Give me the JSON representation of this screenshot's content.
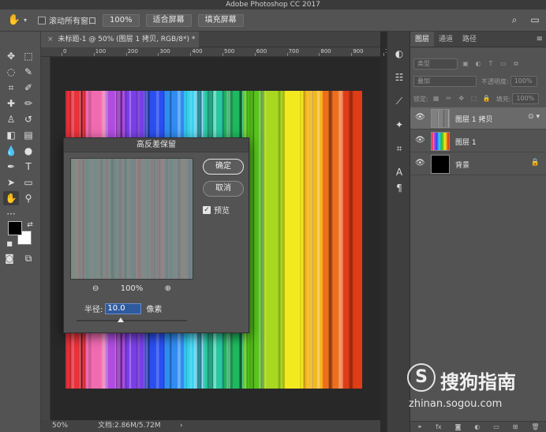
{
  "app": {
    "title": "Adobe Photoshop CC 2017"
  },
  "options_bar": {
    "tool_icon": "hand-icon",
    "scroll_all_windows_label": "滚动所有窗口",
    "scroll_all_windows_checked": false,
    "zoom_100_label": "100%",
    "fit_screen_label": "适合屏幕",
    "fill_screen_label": "填充屏幕"
  },
  "document": {
    "tab_title": "未标题-1 @ 50% (图层 1 拷贝, RGB/8*) *",
    "ruler_marks": [
      "0",
      "100",
      "200",
      "300",
      "400",
      "500",
      "600",
      "700",
      "800",
      "900",
      "1000"
    ],
    "status_zoom": "50%",
    "status_doc": "文档:2.86M/5.72M",
    "status_arrow": "›",
    "stripe_colors": [
      "#e8323c",
      "#f06bb0",
      "#b04ce0",
      "#7a3ee8",
      "#2a4ef0",
      "#2f8cf2",
      "#35d0ee",
      "#28c8a0",
      "#1fb860",
      "#58c41e",
      "#a8d820",
      "#f2ea1e",
      "#f2b81e",
      "#ee6e1e",
      "#e03c18"
    ]
  },
  "dialog": {
    "title": "高反差保留",
    "ok_label": "确定",
    "cancel_label": "取消",
    "preview_label": "预览",
    "preview_checked": true,
    "zoom_level": "100%",
    "radius_label": "半径:",
    "radius_value": "10.0",
    "radius_unit": "像素",
    "radius_slider_fraction": 0.4
  },
  "layers_panel": {
    "tabs": [
      "图层",
      "通道",
      "路径"
    ],
    "active_tab": 0,
    "filter_placeholder": "类型",
    "blend_mode": "叠加",
    "opacity_label": "不透明度:",
    "opacity_value": "100%",
    "lock_label": "锁定:",
    "fill_label": "填充:",
    "fill_value": "100%",
    "layers": [
      {
        "name": "图层 1 拷贝",
        "visible": true,
        "selected": true,
        "thumb": "gray-stripes"
      },
      {
        "name": "图层 1",
        "visible": true,
        "selected": false,
        "thumb": "color-stripes"
      },
      {
        "name": "背景",
        "visible": true,
        "selected": false,
        "thumb": "black",
        "locked": true
      }
    ]
  },
  "watermark": {
    "logo": "S",
    "brand": "搜狗指南",
    "url": "zhinan.sogou.com"
  }
}
